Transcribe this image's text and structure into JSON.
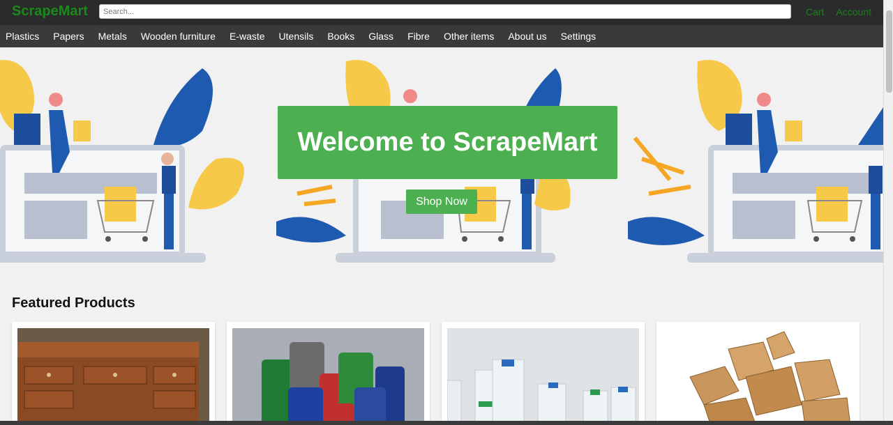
{
  "header": {
    "logo": "ScrapeMart",
    "search_placeholder": "Search...",
    "links": [
      "Cart",
      "Account"
    ]
  },
  "nav": {
    "items": [
      "Plastics",
      "Papers",
      "Metals",
      "Wooden furniture",
      "E-waste",
      "Utensils",
      "Books",
      "Glass",
      "Fibre",
      "Other items",
      "About us",
      "Settings"
    ]
  },
  "hero": {
    "title": "Welcome to ScrapeMart",
    "button": "Shop Now"
  },
  "featured": {
    "title": "Featured Products",
    "products": [
      {
        "image": "wooden-desk-image"
      },
      {
        "image": "metal-cans-image"
      },
      {
        "image": "plastic-bottles-image"
      },
      {
        "image": "cardboard-boxes-image"
      }
    ]
  },
  "colors": {
    "brand_green": "#4caf50",
    "logo_green": "#1a8a1a",
    "topbar": "#2b2b2b",
    "navbar": "#3a3a3a"
  }
}
